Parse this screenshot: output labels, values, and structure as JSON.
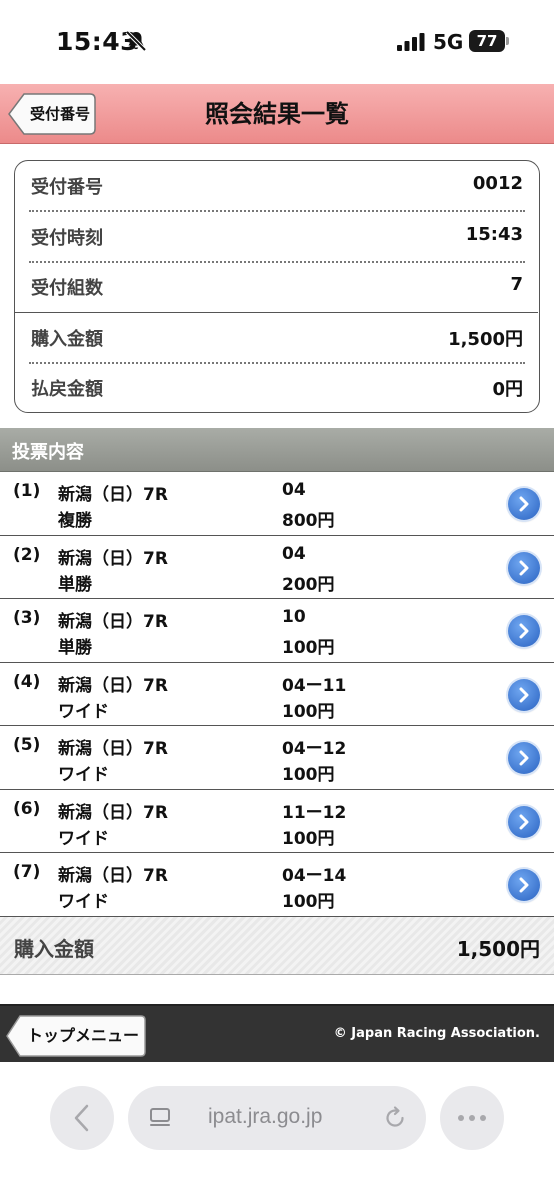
{
  "status": {
    "time": "15:43",
    "network": "5G",
    "battery": "77"
  },
  "header": {
    "back_label": "受付番号",
    "title": "照会結果一覧"
  },
  "summary": {
    "rows": [
      {
        "label": "受付番号",
        "value": "0012"
      },
      {
        "label": "受付時刻",
        "value": "15:43"
      },
      {
        "label": "受付組数",
        "value": "7"
      },
      {
        "label": "購入金額",
        "value": "1,500円"
      },
      {
        "label": "払戻金額",
        "value": "0円"
      }
    ]
  },
  "section": {
    "title": "投票内容"
  },
  "tickets": [
    {
      "no": "(1)",
      "race": "新潟（日）7R",
      "type": "複勝",
      "horses": "04",
      "amount": "800円"
    },
    {
      "no": "(2)",
      "race": "新潟（日）7R",
      "type": "単勝",
      "horses": "04",
      "amount": "200円"
    },
    {
      "no": "(3)",
      "race": "新潟（日）7R",
      "type": "単勝",
      "horses": "10",
      "amount": "100円"
    },
    {
      "no": "(4)",
      "race": "新潟（日）7R",
      "type": "ワイド",
      "horses": "04ー11",
      "amount": "100円"
    },
    {
      "no": "(5)",
      "race": "新潟（日）7R",
      "type": "ワイド",
      "horses": "04ー12",
      "amount": "100円"
    },
    {
      "no": "(6)",
      "race": "新潟（日）7R",
      "type": "ワイド",
      "horses": "11ー12",
      "amount": "100円"
    },
    {
      "no": "(7)",
      "race": "新潟（日）7R",
      "type": "ワイド",
      "horses": "04ー14",
      "amount": "100円"
    }
  ],
  "total": {
    "label": "購入金額",
    "value": "1,500円"
  },
  "footer": {
    "top_menu_label": "トップメニュー",
    "copyright": "© Japan Racing Association."
  },
  "browser": {
    "url": "ipat.jra.go.jp"
  },
  "icons": {
    "bell": "bell-slash-icon",
    "arrow": "chevron-right-icon",
    "accent": "#2a63c2",
    "header_color": "#ec8a8a"
  }
}
